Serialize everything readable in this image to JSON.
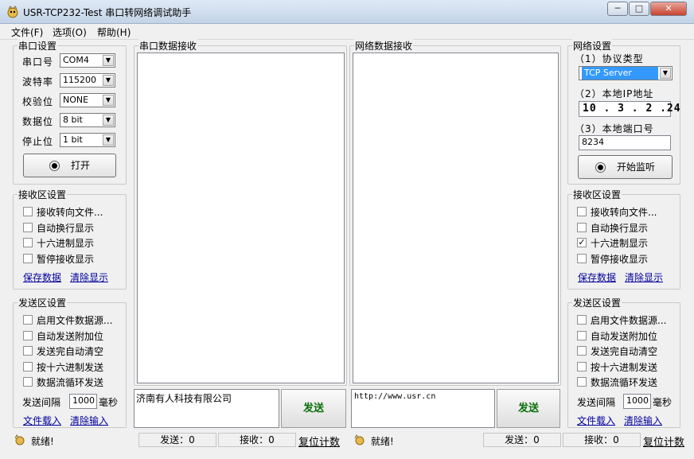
{
  "window": {
    "title": "USR-TCP232-Test 串口转网络调试助手",
    "minimize": "─",
    "maximize": "□",
    "close": "✕"
  },
  "menu": [
    "文件(F)",
    "选项(O)",
    "帮助(H)"
  ],
  "serial_settings": {
    "title": "串口设置",
    "fields": [
      {
        "label": "串口号",
        "value": "COM4"
      },
      {
        "label": "波特率",
        "value": "115200"
      },
      {
        "label": "校验位",
        "value": "NONE"
      },
      {
        "label": "数据位",
        "value": "8 bit"
      },
      {
        "label": "停止位",
        "value": "1 bit"
      }
    ],
    "open_button": "打开"
  },
  "left_receive": {
    "title": "接收区设置",
    "options": [
      {
        "label": "接收转向文件...",
        "checked": false
      },
      {
        "label": "自动换行显示",
        "checked": false
      },
      {
        "label": "十六进制显示",
        "checked": false
      },
      {
        "label": "暂停接收显示",
        "checked": false
      }
    ],
    "save_link": "保存数据",
    "clear_link": "清除显示"
  },
  "left_send": {
    "title": "发送区设置",
    "options": [
      {
        "label": "启用文件数据源...",
        "checked": false
      },
      {
        "label": "自动发送附加位",
        "checked": false
      },
      {
        "label": "发送完自动清空",
        "checked": false
      },
      {
        "label": "按十六进制发送",
        "checked": false
      },
      {
        "label": "数据流循环发送",
        "checked": false
      }
    ],
    "interval_label": "发送间隔",
    "interval_value": "1000",
    "interval_unit": "毫秒",
    "load_link": "文件载入",
    "clear_link": "清除输入"
  },
  "serial_receive": {
    "title": "串口数据接收"
  },
  "net_receive": {
    "title": "网络数据接收"
  },
  "serial_send": {
    "text": "济南有人科技有限公司",
    "button": "发送"
  },
  "net_send": {
    "text": "http://www.usr.cn",
    "button": "发送"
  },
  "net_settings": {
    "title": "网络设置",
    "protocol_label": "（1）协议类型",
    "protocol_value": "TCP Server",
    "ip_label": "（2）本地IP地址",
    "ip_value": "10 . 3 . 2 .24",
    "port_label": "（3）本地端口号",
    "port_value": "8234",
    "listen_button": "开始监听"
  },
  "right_receive": {
    "title": "接收区设置",
    "options": [
      {
        "label": "接收转向文件...",
        "checked": false
      },
      {
        "label": "自动换行显示",
        "checked": false
      },
      {
        "label": "十六进制显示",
        "checked": true
      },
      {
        "label": "暂停接收显示",
        "checked": false
      }
    ],
    "save_link": "保存数据",
    "clear_link": "清除显示"
  },
  "right_send": {
    "title": "发送区设置",
    "options": [
      {
        "label": "启用文件数据源...",
        "checked": false
      },
      {
        "label": "自动发送附加位",
        "checked": false
      },
      {
        "label": "发送完自动清空",
        "checked": false
      },
      {
        "label": "按十六进制发送",
        "checked": false
      },
      {
        "label": "数据流循环发送",
        "checked": false
      }
    ],
    "interval_label": "发送间隔",
    "interval_value": "1000",
    "interval_unit": "毫秒",
    "load_link": "文件载入",
    "clear_link": "清除输入"
  },
  "status_left": {
    "ready": "就绪!",
    "sent": "发送：0",
    "received": "接收：0",
    "reset": "复位计数"
  },
  "status_right": {
    "ready": "就绪!",
    "sent": "发送：0",
    "received": "接收：0",
    "reset": "复位计数"
  },
  "colors": {
    "titlebar": "#c3d4e7",
    "send_text": "#0a6e0a",
    "link": "#00009c"
  }
}
